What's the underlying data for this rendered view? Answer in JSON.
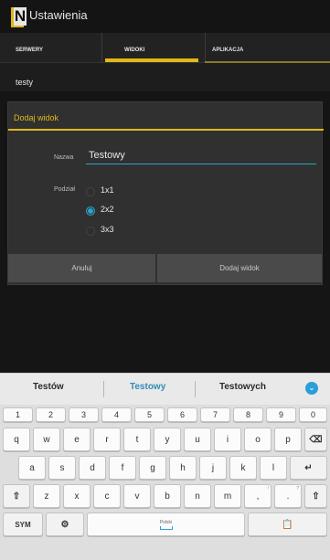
{
  "app": {
    "logo_letter": "N",
    "title": "Ustawienia"
  },
  "tabs": [
    {
      "label": "SERWERY"
    },
    {
      "label": "WIDOKI"
    },
    {
      "label": "APLIKACJA"
    }
  ],
  "list": {
    "first_item": "testy"
  },
  "dialog": {
    "title": "Dodaj widok",
    "name_label": "Nazwa",
    "name_value": "Testowy",
    "split_label": "Podział",
    "options": [
      "1x1",
      "2x2",
      "3x3"
    ],
    "selected_option": "2x2",
    "cancel_label": "Anuluj",
    "add_label": "Dodaj widok"
  },
  "suggestions": [
    "Testów",
    "Testowy",
    "Testowych"
  ],
  "keyboard": {
    "numbers": [
      "1",
      "2",
      "3",
      "4",
      "5",
      "6",
      "7",
      "8",
      "9",
      "0"
    ],
    "row1": [
      "q",
      "w",
      "e",
      "r",
      "t",
      "y",
      "u",
      "i",
      "o",
      "p"
    ],
    "row2": [
      "a",
      "s",
      "d",
      "f",
      "g",
      "h",
      "j",
      "k",
      "l"
    ],
    "row3": [
      "z",
      "x",
      "c",
      "v",
      "b",
      "n",
      "m",
      ",",
      "."
    ],
    "row3_sub": [
      "!",
      "?"
    ],
    "sym_label": "SYM",
    "space_label": "Polski"
  },
  "colors": {
    "accent": "#e0b819",
    "focus": "#2aa5c9",
    "suggestion_highlight": "#2f8db6"
  }
}
